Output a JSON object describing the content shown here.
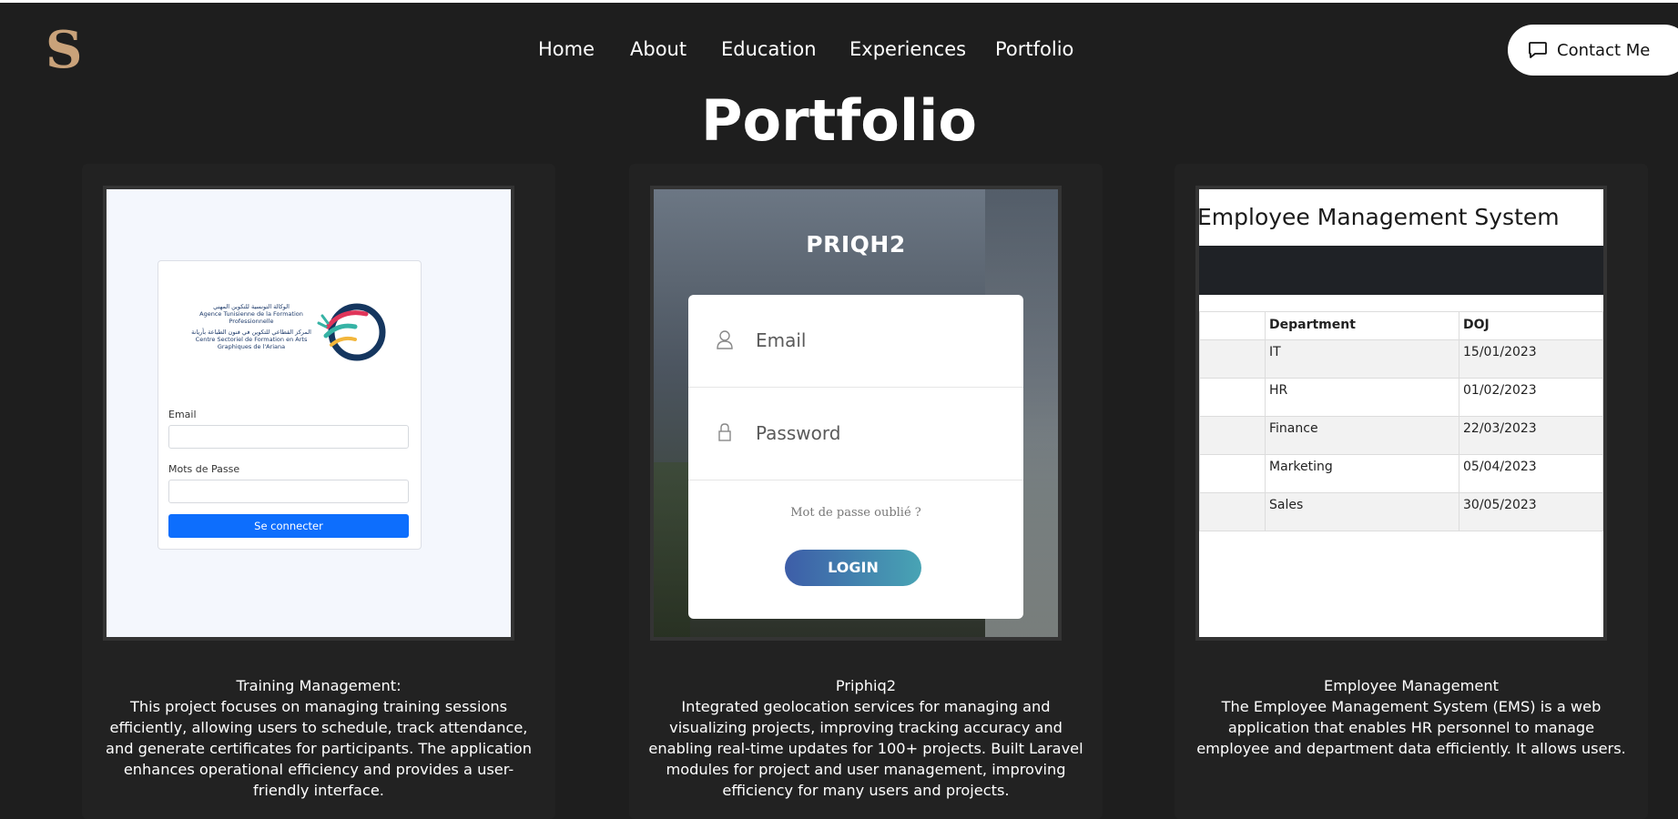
{
  "header": {
    "logo": "S",
    "nav": [
      "Home",
      "About",
      "Education",
      "Experiences",
      "Portfolio"
    ],
    "contact_label": "Contact Me"
  },
  "section_title": "Portfolio",
  "projects": [
    {
      "title": "Training Management:",
      "description": "This project focuses on managing training sessions efficiently, allowing users to schedule, track attendance, and generate certificates for participants. The application enhances operational efficiency and provides a user-friendly interface.",
      "screenshot": {
        "org_lines": [
          "الوكالة التونسية للتكوين المهني",
          "Agence Tunisienne de la Formation",
          "Professionnelle",
          "المركز القطاعي للتكوين في فنون الطباعة بأريانة",
          "Centre Sectoriel de Formation en Arts",
          "Graphiques de l'Ariana"
        ],
        "email_label": "Email",
        "password_label": "Mots de Passe",
        "button": "Se connecter"
      }
    },
    {
      "title": "Priphiq2",
      "description": "Integrated geolocation services for managing and visualizing projects, improving tracking accuracy and enabling real-time updates for 100+ projects. Built Laravel modules for project and user management, improving efficiency for many users and projects.",
      "screenshot": {
        "brand": "PRIQH2",
        "email_placeholder": "Email",
        "password_placeholder": "Password",
        "forgot": "Mot de passe oublié ?",
        "button": "LOGIN"
      }
    },
    {
      "title": "Employee Management",
      "description": "The Employee Management System (EMS) is a web application that enables HR personnel to manage employee and department data efficiently. It allows users.",
      "screenshot": {
        "heading": "Employee Management System",
        "columns": [
          "Department",
          "DOJ"
        ],
        "rows": [
          [
            "IT",
            "15/01/2023"
          ],
          [
            "HR",
            "01/02/2023"
          ],
          [
            "Finance",
            "22/03/2023"
          ],
          [
            "Marketing",
            "05/04/2023"
          ],
          [
            "Sales",
            "30/05/2023"
          ]
        ]
      }
    }
  ]
}
